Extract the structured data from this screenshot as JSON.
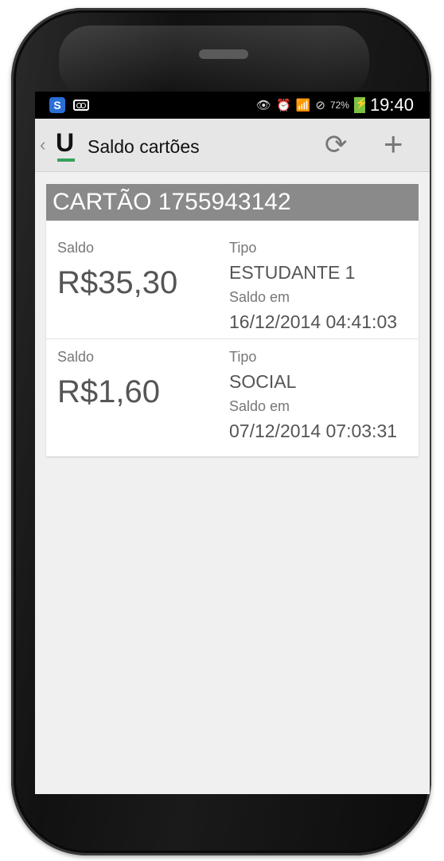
{
  "status_bar": {
    "battery_percent": "72%",
    "time": "19:40",
    "icons": [
      "skype-icon",
      "voicemail-icon",
      "eye-icon",
      "alarm-icon",
      "wifi-icon",
      "no-sync-icon",
      "battery-charging-icon"
    ]
  },
  "action_bar": {
    "logo_letter": "U",
    "title": "Saldo cartões"
  },
  "card": {
    "header": "CARTÃO 1755943142",
    "entries": [
      {
        "saldo_label": "Saldo",
        "saldo_value": "R$35,30",
        "tipo_label": "Tipo",
        "tipo_value": "ESTUDANTE 1",
        "saldo_em_label": "Saldo em",
        "saldo_em_value": "16/12/2014 04:41:03"
      },
      {
        "saldo_label": "Saldo",
        "saldo_value": "R$1,60",
        "tipo_label": "Tipo",
        "tipo_value": "SOCIAL",
        "saldo_em_label": "Saldo em",
        "saldo_em_value": "07/12/2014 07:03:31"
      }
    ]
  },
  "colors": {
    "accent": "#38a15b",
    "header_bg": "#8a8a8a",
    "action_bar_bg": "#e6e6e6",
    "screen_bg": "#f0f0f0"
  }
}
